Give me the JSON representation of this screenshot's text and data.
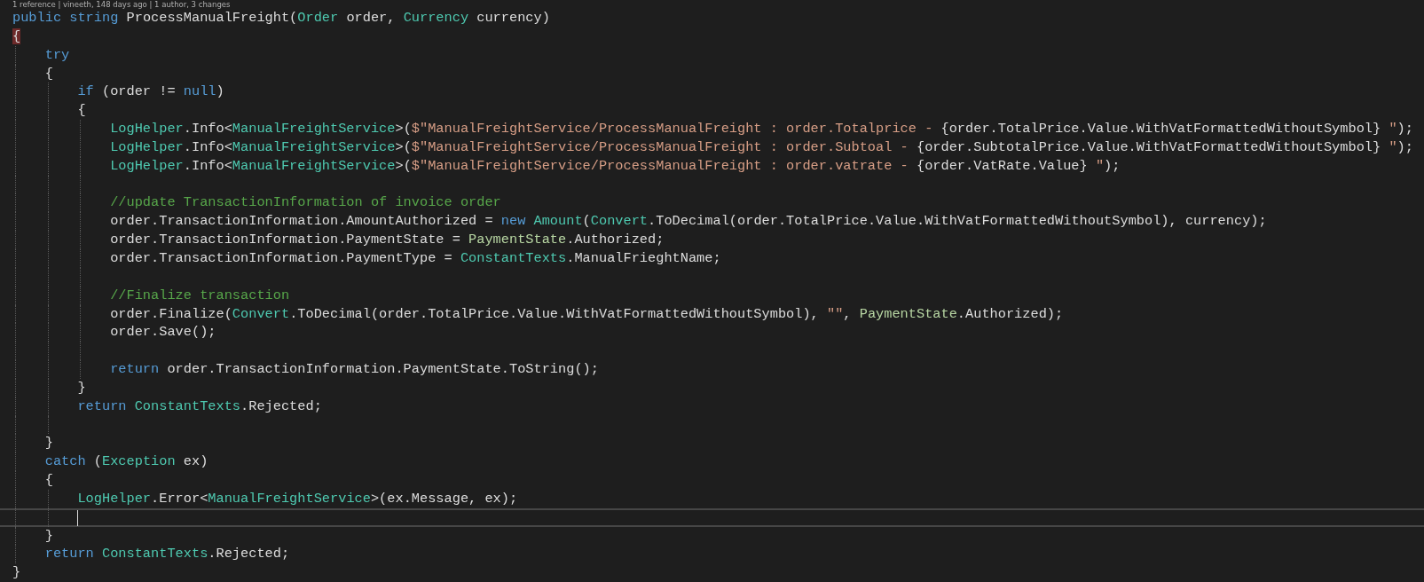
{
  "codelens": "1 reference | vineeth, 148 days ago | 1 author, 3 changes",
  "lines": [
    {
      "current": false,
      "tokens": [
        {
          "kind": "keyword",
          "text": "public"
        },
        {
          "kind": "keyword",
          "text": " string"
        },
        {
          "kind": "plain",
          "text": " ProcessManualFreight("
        },
        {
          "kind": "type",
          "text": "Order"
        },
        {
          "kind": "plain",
          "text": " order, "
        },
        {
          "kind": "type",
          "text": "Currency"
        },
        {
          "kind": "plain",
          "text": " currency)"
        }
      ]
    },
    {
      "current": false,
      "tokens": [
        {
          "kind": "plain",
          "text": "{",
          "matched": true
        }
      ]
    },
    {
      "current": false,
      "tokens": [
        {
          "kind": "keyword",
          "text": "    try"
        }
      ]
    },
    {
      "current": false,
      "tokens": [
        {
          "kind": "plain",
          "text": "    {"
        }
      ]
    },
    {
      "current": false,
      "tokens": [
        {
          "kind": "keyword",
          "text": "        if"
        },
        {
          "kind": "plain",
          "text": " (order != "
        },
        {
          "kind": "keyword",
          "text": "null"
        },
        {
          "kind": "plain",
          "text": ")"
        }
      ]
    },
    {
      "current": false,
      "tokens": [
        {
          "kind": "plain",
          "text": "        {"
        }
      ]
    },
    {
      "current": false,
      "tokens": [
        {
          "kind": "type",
          "text": "            LogHelper"
        },
        {
          "kind": "plain",
          "text": ".Info<"
        },
        {
          "kind": "type",
          "text": "ManualFreightService"
        },
        {
          "kind": "plain",
          "text": ">("
        },
        {
          "kind": "string",
          "text": "$\"ManualFreightService/ProcessManualFreight : order.Totalprice - "
        },
        {
          "kind": "plain",
          "text": "{order.TotalPrice.Value.WithVatFormattedWithoutSymbol}"
        },
        {
          "kind": "string",
          "text": " \""
        },
        {
          "kind": "plain",
          "text": ");"
        }
      ]
    },
    {
      "current": false,
      "tokens": [
        {
          "kind": "type",
          "text": "            LogHelper"
        },
        {
          "kind": "plain",
          "text": ".Info<"
        },
        {
          "kind": "type",
          "text": "ManualFreightService"
        },
        {
          "kind": "plain",
          "text": ">("
        },
        {
          "kind": "string",
          "text": "$\"ManualFreightService/ProcessManualFreight : order.Subtoal - "
        },
        {
          "kind": "plain",
          "text": "{order.SubtotalPrice.Value.WithVatFormattedWithoutSymbol}"
        },
        {
          "kind": "string",
          "text": " \""
        },
        {
          "kind": "plain",
          "text": ");"
        }
      ]
    },
    {
      "current": false,
      "tokens": [
        {
          "kind": "type",
          "text": "            LogHelper"
        },
        {
          "kind": "plain",
          "text": ".Info<"
        },
        {
          "kind": "type",
          "text": "ManualFreightService"
        },
        {
          "kind": "plain",
          "text": ">("
        },
        {
          "kind": "string",
          "text": "$\"ManualFreightService/ProcessManualFreight : order.vatrate - "
        },
        {
          "kind": "plain",
          "text": "{order.VatRate.Value}"
        },
        {
          "kind": "string",
          "text": " \""
        },
        {
          "kind": "plain",
          "text": ");"
        }
      ]
    },
    {
      "current": false
    },
    {
      "current": false,
      "tokens": [
        {
          "kind": "comment",
          "text": "            //update TransactionInformation of invoice order"
        }
      ]
    },
    {
      "current": false,
      "tokens": [
        {
          "kind": "plain",
          "text": "            order.TransactionInformation.AmountAuthorized = "
        },
        {
          "kind": "keyword",
          "text": "new"
        },
        {
          "kind": "type",
          "text": " Amount"
        },
        {
          "kind": "plain",
          "text": "("
        },
        {
          "kind": "type",
          "text": "Convert"
        },
        {
          "kind": "plain",
          "text": ".ToDecimal(order.TotalPrice.Value.WithVatFormattedWithoutSymbol), currency);"
        }
      ]
    },
    {
      "current": false,
      "tokens": [
        {
          "kind": "plain",
          "text": "            order.TransactionInformation.PaymentState = "
        },
        {
          "kind": "enum",
          "text": "PaymentState"
        },
        {
          "kind": "plain",
          "text": ".Authorized;"
        }
      ]
    },
    {
      "current": false,
      "tokens": [
        {
          "kind": "plain",
          "text": "            order.TransactionInformation.PaymentType = "
        },
        {
          "kind": "type",
          "text": "ConstantTexts"
        },
        {
          "kind": "plain",
          "text": ".ManualFrieghtName;"
        }
      ]
    },
    {
      "current": false
    },
    {
      "current": false,
      "tokens": [
        {
          "kind": "comment",
          "text": "            //Finalize transaction"
        }
      ]
    },
    {
      "current": false,
      "tokens": [
        {
          "kind": "plain",
          "text": "            order.Finalize("
        },
        {
          "kind": "type",
          "text": "Convert"
        },
        {
          "kind": "plain",
          "text": ".ToDecimal(order.TotalPrice.Value.WithVatFormattedWithoutSymbol), "
        },
        {
          "kind": "string",
          "text": "\"\""
        },
        {
          "kind": "plain",
          "text": ", "
        },
        {
          "kind": "enum",
          "text": "PaymentState"
        },
        {
          "kind": "plain",
          "text": ".Authorized);"
        }
      ]
    },
    {
      "current": false,
      "tokens": [
        {
          "kind": "plain",
          "text": "            order.Save();"
        }
      ]
    },
    {
      "current": false
    },
    {
      "current": false,
      "tokens": [
        {
          "kind": "keyword",
          "text": "            return"
        },
        {
          "kind": "plain",
          "text": " order.TransactionInformation.PaymentState.ToString();"
        }
      ]
    },
    {
      "current": false,
      "tokens": [
        {
          "kind": "plain",
          "text": "        }"
        }
      ]
    },
    {
      "current": false,
      "tokens": [
        {
          "kind": "keyword",
          "text": "        return"
        },
        {
          "kind": "type",
          "text": " ConstantTexts"
        },
        {
          "kind": "plain",
          "text": ".Rejected;"
        }
      ]
    },
    {
      "current": false
    },
    {
      "current": false,
      "tokens": [
        {
          "kind": "plain",
          "text": "    }"
        }
      ]
    },
    {
      "current": false,
      "tokens": [
        {
          "kind": "keyword",
          "text": "    catch"
        },
        {
          "kind": "plain",
          "text": " ("
        },
        {
          "kind": "type",
          "text": "Exception"
        },
        {
          "kind": "plain",
          "text": " ex)"
        }
      ]
    },
    {
      "current": false,
      "tokens": [
        {
          "kind": "plain",
          "text": "    {"
        }
      ]
    },
    {
      "current": false,
      "tokens": [
        {
          "kind": "type",
          "text": "        LogHelper"
        },
        {
          "kind": "plain",
          "text": ".Error<"
        },
        {
          "kind": "type",
          "text": "ManualFreightService"
        },
        {
          "kind": "plain",
          "text": ">(ex.Message, ex);"
        }
      ]
    },
    {
      "current": true
    },
    {
      "current": false,
      "tokens": [
        {
          "kind": "plain",
          "text": "    }"
        }
      ]
    },
    {
      "current": false,
      "tokens": [
        {
          "kind": "keyword",
          "text": "    return"
        },
        {
          "kind": "type",
          "text": " ConstantTexts"
        },
        {
          "kind": "plain",
          "text": ".Rejected;"
        }
      ]
    },
    {
      "current": false,
      "tokens": [
        {
          "kind": "plain",
          "text": "}"
        }
      ]
    }
  ]
}
